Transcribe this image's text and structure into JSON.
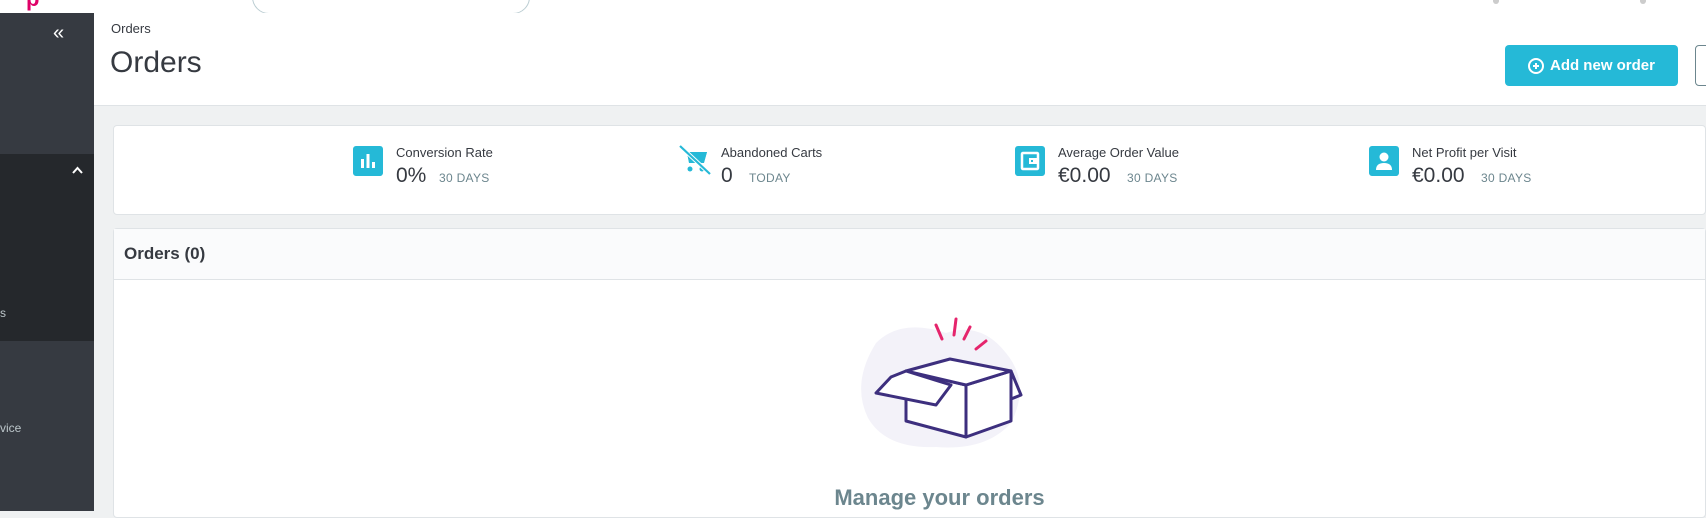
{
  "header": {
    "logo_fragment": "p"
  },
  "sidebar": {
    "collapse_icon": "double-chevron-left-icon",
    "fragments": [
      "s",
      "vice"
    ]
  },
  "page": {
    "breadcrumb": "Orders",
    "title": "Orders",
    "add_button": "Add new order"
  },
  "kpis": [
    {
      "label": "Conversion Rate",
      "value": "0%",
      "period": "30 DAYS",
      "icon": "bar-chart-icon"
    },
    {
      "label": "Abandoned Carts",
      "value": "0",
      "period": "TODAY",
      "icon": "cart-off-icon"
    },
    {
      "label": "Average Order Value",
      "value": "€0.00",
      "period": "30 DAYS",
      "icon": "wallet-icon"
    },
    {
      "label": "Net Profit per Visit",
      "value": "€0.00",
      "period": "30 DAYS",
      "icon": "user-icon"
    }
  ],
  "orders": {
    "title": "Orders (0)",
    "empty_title": "Manage your orders"
  },
  "colors": {
    "accent": "#25b9d7",
    "sidebar": "#363a41",
    "sidebar_active": "#25282c",
    "brand": "#df0067",
    "illustration_stroke": "#3d2f7e"
  }
}
